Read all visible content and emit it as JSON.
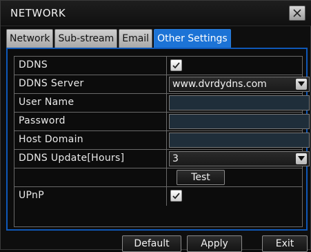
{
  "window": {
    "title": "NETWORK"
  },
  "tabs": [
    {
      "label": "Network",
      "active": false
    },
    {
      "label": "Sub-stream",
      "active": false
    },
    {
      "label": "Email",
      "active": false
    },
    {
      "label": "Other Settings",
      "active": true
    }
  ],
  "settings": {
    "ddns": {
      "label": "DDNS",
      "checked": true
    },
    "ddns_server": {
      "label": "DDNS Server",
      "value": "www.dvrdydns.com"
    },
    "user_name": {
      "label": "User Name",
      "value": ""
    },
    "password": {
      "label": "Password",
      "value": ""
    },
    "host_domain": {
      "label": "Host Domain",
      "value": ""
    },
    "ddns_update": {
      "label": "DDNS Update[Hours]",
      "value": "3"
    },
    "test_button": {
      "label": "Test"
    },
    "upnp": {
      "label": "UPnP",
      "checked": true
    }
  },
  "footer": {
    "default_label": "Default",
    "apply_label": "Apply",
    "exit_label": "Exit"
  },
  "colors": {
    "accent_tab": "#1c73d6",
    "panel_border": "#0f58b8",
    "background": "#0e0e0e"
  }
}
